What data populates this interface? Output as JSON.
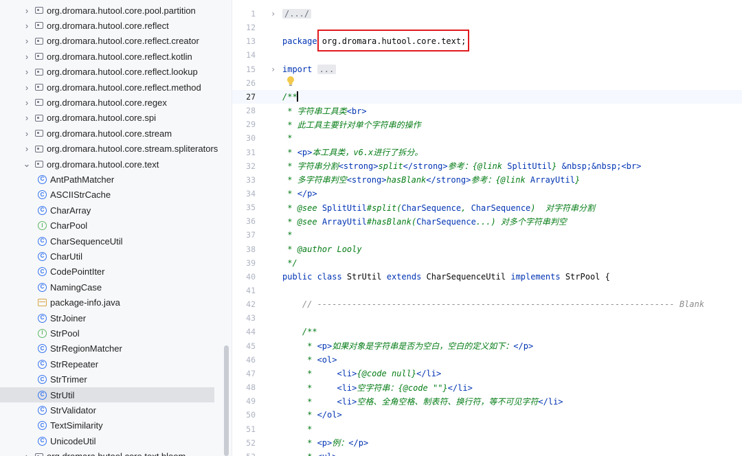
{
  "sidebar": {
    "rows": [
      {
        "kind": "package",
        "label": "org.dromara.hutool.core.pool.partition",
        "chevron": "collapsed"
      },
      {
        "kind": "package",
        "label": "org.dromara.hutool.core.reflect",
        "chevron": "collapsed"
      },
      {
        "kind": "package",
        "label": "org.dromara.hutool.core.reflect.creator",
        "chevron": "collapsed"
      },
      {
        "kind": "package",
        "label": "org.dromara.hutool.core.reflect.kotlin",
        "chevron": "collapsed"
      },
      {
        "kind": "package",
        "label": "org.dromara.hutool.core.reflect.lookup",
        "chevron": "collapsed"
      },
      {
        "kind": "package",
        "label": "org.dromara.hutool.core.reflect.method",
        "chevron": "collapsed"
      },
      {
        "kind": "package",
        "label": "org.dromara.hutool.core.regex",
        "chevron": "collapsed"
      },
      {
        "kind": "package",
        "label": "org.dromara.hutool.core.spi",
        "chevron": "collapsed"
      },
      {
        "kind": "package",
        "label": "org.dromara.hutool.core.stream",
        "chevron": "collapsed"
      },
      {
        "kind": "package",
        "label": "org.dromara.hutool.core.stream.spliterators",
        "chevron": "collapsed"
      },
      {
        "kind": "package",
        "label": "org.dromara.hutool.core.text",
        "chevron": "expanded"
      },
      {
        "kind": "class",
        "label": "AntPathMatcher"
      },
      {
        "kind": "class",
        "label": "ASCIIStrCache"
      },
      {
        "kind": "class",
        "label": "CharArray"
      },
      {
        "kind": "interface",
        "label": "CharPool"
      },
      {
        "kind": "class",
        "label": "CharSequenceUtil"
      },
      {
        "kind": "class",
        "label": "CharUtil"
      },
      {
        "kind": "class",
        "label": "CodePointIter"
      },
      {
        "kind": "class",
        "label": "NamingCase"
      },
      {
        "kind": "file",
        "label": "package-info.java"
      },
      {
        "kind": "class",
        "label": "StrJoiner"
      },
      {
        "kind": "interface",
        "label": "StrPool"
      },
      {
        "kind": "class",
        "label": "StrRegionMatcher"
      },
      {
        "kind": "class",
        "label": "StrRepeater"
      },
      {
        "kind": "class",
        "label": "StrTrimer"
      },
      {
        "kind": "class",
        "label": "StrUtil",
        "selected": true
      },
      {
        "kind": "class",
        "label": "StrValidator"
      },
      {
        "kind": "class",
        "label": "TextSimilarity"
      },
      {
        "kind": "class",
        "label": "UnicodeUtil"
      },
      {
        "kind": "package",
        "label": "org.dromara.hutool.core.text.bloom",
        "chevron": "collapsed"
      }
    ]
  },
  "icons": {
    "chevron_collapsed": "›",
    "chevron_expanded": "⌄",
    "class_glyph": "C",
    "interface_glyph": "I",
    "fold_marker": "›"
  },
  "colors": {
    "keyword": "#0033b3",
    "javadoc": "#067d17",
    "comment": "#8c8c8c",
    "highlight_box": "#e0191e",
    "class_icon": "#3574f0",
    "interface_icon": "#5fb865"
  },
  "editor": {
    "current_line": "27",
    "lines": [
      {
        "num": "1",
        "fold": true,
        "parts": [
          {
            "t": "/.../",
            "c": "folded"
          }
        ]
      },
      {
        "num": "12",
        "parts": []
      },
      {
        "num": "13",
        "parts": [
          {
            "t": "package ",
            "c": "kw"
          },
          {
            "t": "org.dromara.hutool.core.text;",
            "c": ""
          }
        ]
      },
      {
        "num": "14",
        "parts": []
      },
      {
        "num": "15",
        "fold": true,
        "parts": [
          {
            "t": "import ",
            "c": "kw"
          },
          {
            "t": "...",
            "c": "folded"
          }
        ]
      },
      {
        "num": "26",
        "parts": []
      },
      {
        "num": "27",
        "parts": [
          {
            "t": "/**",
            "c": "doc"
          }
        ]
      },
      {
        "num": "28",
        "parts": [
          {
            "t": " * 字符串工具类",
            "c": "doc"
          },
          {
            "t": "<br>",
            "c": "tag"
          }
        ]
      },
      {
        "num": "29",
        "parts": [
          {
            "t": " * 此工具主要针对单个字符串的操作",
            "c": "doc"
          }
        ]
      },
      {
        "num": "30",
        "parts": [
          {
            "t": " *",
            "c": "doc"
          }
        ]
      },
      {
        "num": "31",
        "parts": [
          {
            "t": " * ",
            "c": "doc"
          },
          {
            "t": "<p>",
            "c": "tag"
          },
          {
            "t": "本工具类，v6.x进行了拆分。",
            "c": "doc"
          }
        ]
      },
      {
        "num": "32",
        "parts": [
          {
            "t": " * 字符串分割",
            "c": "doc"
          },
          {
            "t": "<strong>",
            "c": "tag"
          },
          {
            "t": "split",
            "c": "tagtxt"
          },
          {
            "t": "</strong>",
            "c": "tag"
          },
          {
            "t": "参考：{",
            "c": "doc"
          },
          {
            "t": "@link ",
            "c": "doctag"
          },
          {
            "t": "SplitUtil",
            "c": "kw"
          },
          {
            "t": "} ",
            "c": "doc"
          },
          {
            "t": "&nbsp;&nbsp;",
            "c": "kw"
          },
          {
            "t": "<br>",
            "c": "tag"
          }
        ]
      },
      {
        "num": "33",
        "parts": [
          {
            "t": " * 多字符串判空",
            "c": "doc"
          },
          {
            "t": "<strong>",
            "c": "tag"
          },
          {
            "t": "hasBlank",
            "c": "tagtxt"
          },
          {
            "t": "</strong>",
            "c": "tag"
          },
          {
            "t": "参考：{",
            "c": "doc"
          },
          {
            "t": "@link ",
            "c": "doctag"
          },
          {
            "t": "ArrayUtil",
            "c": "kw"
          },
          {
            "t": "}",
            "c": "doc"
          }
        ]
      },
      {
        "num": "34",
        "parts": [
          {
            "t": " * ",
            "c": "doc"
          },
          {
            "t": "</p>",
            "c": "tag"
          }
        ]
      },
      {
        "num": "35",
        "parts": [
          {
            "t": " * ",
            "c": "doc"
          },
          {
            "t": "@see ",
            "c": "doctag"
          },
          {
            "t": "SplitUtil",
            "c": "kw"
          },
          {
            "t": "#split(",
            "c": "doc"
          },
          {
            "t": "CharSequence",
            "c": "kw"
          },
          {
            "t": ", ",
            "c": "doc"
          },
          {
            "t": "CharSequence",
            "c": "kw"
          },
          {
            "t": ")  对字符串分割",
            "c": "doc"
          }
        ]
      },
      {
        "num": "36",
        "parts": [
          {
            "t": " * ",
            "c": "doc"
          },
          {
            "t": "@see ",
            "c": "doctag"
          },
          {
            "t": "ArrayUtil",
            "c": "kw"
          },
          {
            "t": "#hasBlank(",
            "c": "doc"
          },
          {
            "t": "CharSequence",
            "c": "kw"
          },
          {
            "t": "...) 对多个字符串判空",
            "c": "doc"
          }
        ]
      },
      {
        "num": "37",
        "parts": [
          {
            "t": " *",
            "c": "doc"
          }
        ]
      },
      {
        "num": "38",
        "parts": [
          {
            "t": " * ",
            "c": "doc"
          },
          {
            "t": "@author ",
            "c": "doctag"
          },
          {
            "t": "Looly",
            "c": "doc"
          }
        ]
      },
      {
        "num": "39",
        "parts": [
          {
            "t": " */",
            "c": "doc"
          }
        ]
      },
      {
        "num": "40",
        "parts": [
          {
            "t": "public class ",
            "c": "kw"
          },
          {
            "t": "StrUtil ",
            "c": ""
          },
          {
            "t": "extends ",
            "c": "kw"
          },
          {
            "t": "CharSequenceUtil ",
            "c": ""
          },
          {
            "t": "implements ",
            "c": "kw"
          },
          {
            "t": "StrPool {",
            "c": ""
          }
        ]
      },
      {
        "num": "41",
        "parts": []
      },
      {
        "num": "42",
        "parts": [
          {
            "t": "    // ------------------------------------------------------------------------ Blank",
            "c": "cm"
          }
        ]
      },
      {
        "num": "43",
        "parts": []
      },
      {
        "num": "44",
        "parts": [
          {
            "t": "    /**",
            "c": "doc"
          }
        ]
      },
      {
        "num": "45",
        "parts": [
          {
            "t": "     * ",
            "c": "doc"
          },
          {
            "t": "<p>",
            "c": "tag"
          },
          {
            "t": "如果对象是字符串是否为空白，空白的定义如下：",
            "c": "doc"
          },
          {
            "t": "</p>",
            "c": "tag"
          }
        ]
      },
      {
        "num": "46",
        "parts": [
          {
            "t": "     * ",
            "c": "doc"
          },
          {
            "t": "<ol>",
            "c": "tag"
          }
        ]
      },
      {
        "num": "47",
        "parts": [
          {
            "t": "     *     ",
            "c": "doc"
          },
          {
            "t": "<li>",
            "c": "tag"
          },
          {
            "t": "{",
            "c": "doc"
          },
          {
            "t": "@code ",
            "c": "doctag"
          },
          {
            "t": "null}",
            "c": "doc"
          },
          {
            "t": "</li>",
            "c": "tag"
          }
        ]
      },
      {
        "num": "48",
        "parts": [
          {
            "t": "     *     ",
            "c": "doc"
          },
          {
            "t": "<li>",
            "c": "tag"
          },
          {
            "t": "空字符串：{",
            "c": "doc"
          },
          {
            "t": "@code ",
            "c": "doctag"
          },
          {
            "t": "\"\"}",
            "c": "doc"
          },
          {
            "t": "</li>",
            "c": "tag"
          }
        ]
      },
      {
        "num": "49",
        "parts": [
          {
            "t": "     *     ",
            "c": "doc"
          },
          {
            "t": "<li>",
            "c": "tag"
          },
          {
            "t": "空格、全角空格、制表符、换行符，等不可见字符",
            "c": "doc"
          },
          {
            "t": "</li>",
            "c": "tag"
          }
        ]
      },
      {
        "num": "50",
        "parts": [
          {
            "t": "     * ",
            "c": "doc"
          },
          {
            "t": "</ol>",
            "c": "tag"
          }
        ]
      },
      {
        "num": "51",
        "parts": [
          {
            "t": "     *",
            "c": "doc"
          }
        ]
      },
      {
        "num": "52",
        "parts": [
          {
            "t": "     * ",
            "c": "doc"
          },
          {
            "t": "<p>",
            "c": "tag"
          },
          {
            "t": "例：",
            "c": "doc"
          },
          {
            "t": "</p>",
            "c": "tag"
          }
        ]
      },
      {
        "num": "53",
        "parts": [
          {
            "t": "     * ",
            "c": "doc"
          },
          {
            "t": "<ul>",
            "c": "tag"
          }
        ]
      }
    ]
  }
}
